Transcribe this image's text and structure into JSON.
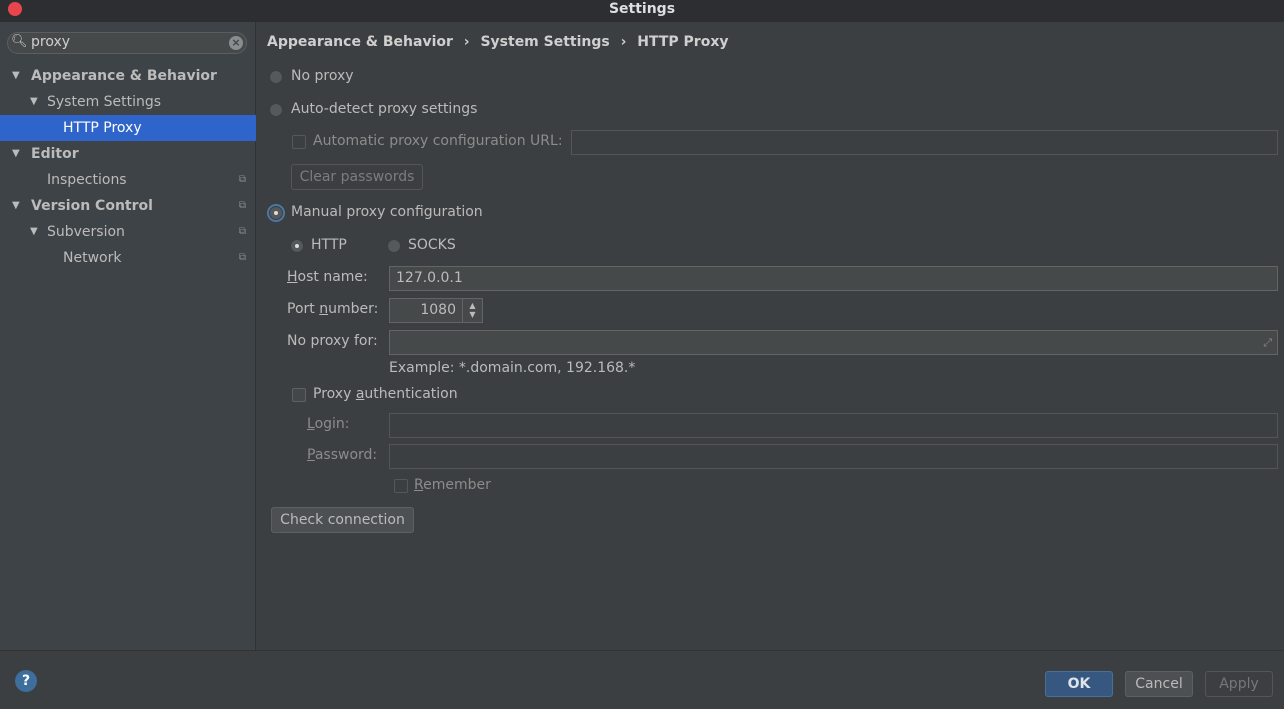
{
  "window": {
    "title": "Settings"
  },
  "search": {
    "value": "proxy"
  },
  "tree": [
    {
      "label": "Appearance & Behavior"
    },
    {
      "label": "System Settings"
    },
    {
      "label": "HTTP Proxy"
    },
    {
      "label": "Editor"
    },
    {
      "label": "Inspections"
    },
    {
      "label": "Version Control"
    },
    {
      "label": "Subversion"
    },
    {
      "label": "Network"
    }
  ],
  "breadcrumb": [
    "Appearance & Behavior",
    "System Settings",
    "HTTP Proxy"
  ],
  "breadcrumb_sep": "›",
  "form": {
    "no_proxy": "No proxy",
    "auto_detect": "Auto-detect proxy settings",
    "auto_url_label": "Automatic proxy configuration URL:",
    "auto_url_value": "",
    "clear_passwords": "Clear passwords",
    "manual": "Manual proxy configuration",
    "http": "HTTP",
    "socks": "SOCKS",
    "host_label_u": "H",
    "host_label_rest": "ost name:",
    "host_value": "127.0.0.1",
    "port_label_a": "Port ",
    "port_label_u": "n",
    "port_label_b": "umber:",
    "port_value": "1080",
    "no_proxy_for_label": "No proxy for:",
    "no_proxy_for_value": "",
    "example": "Example: *.domain.com, 192.168.*",
    "proxy_auth_a": "Proxy ",
    "proxy_auth_u": "a",
    "proxy_auth_b": "uthentication",
    "login_u": "L",
    "login_rest": "ogin:",
    "password_u": "P",
    "password_rest": "assword:",
    "remember_u": "R",
    "remember_rest": "emember",
    "check_connection": "Check connection"
  },
  "footer": {
    "help": "?",
    "ok": "OK",
    "cancel": "Cancel",
    "apply": "Apply"
  }
}
